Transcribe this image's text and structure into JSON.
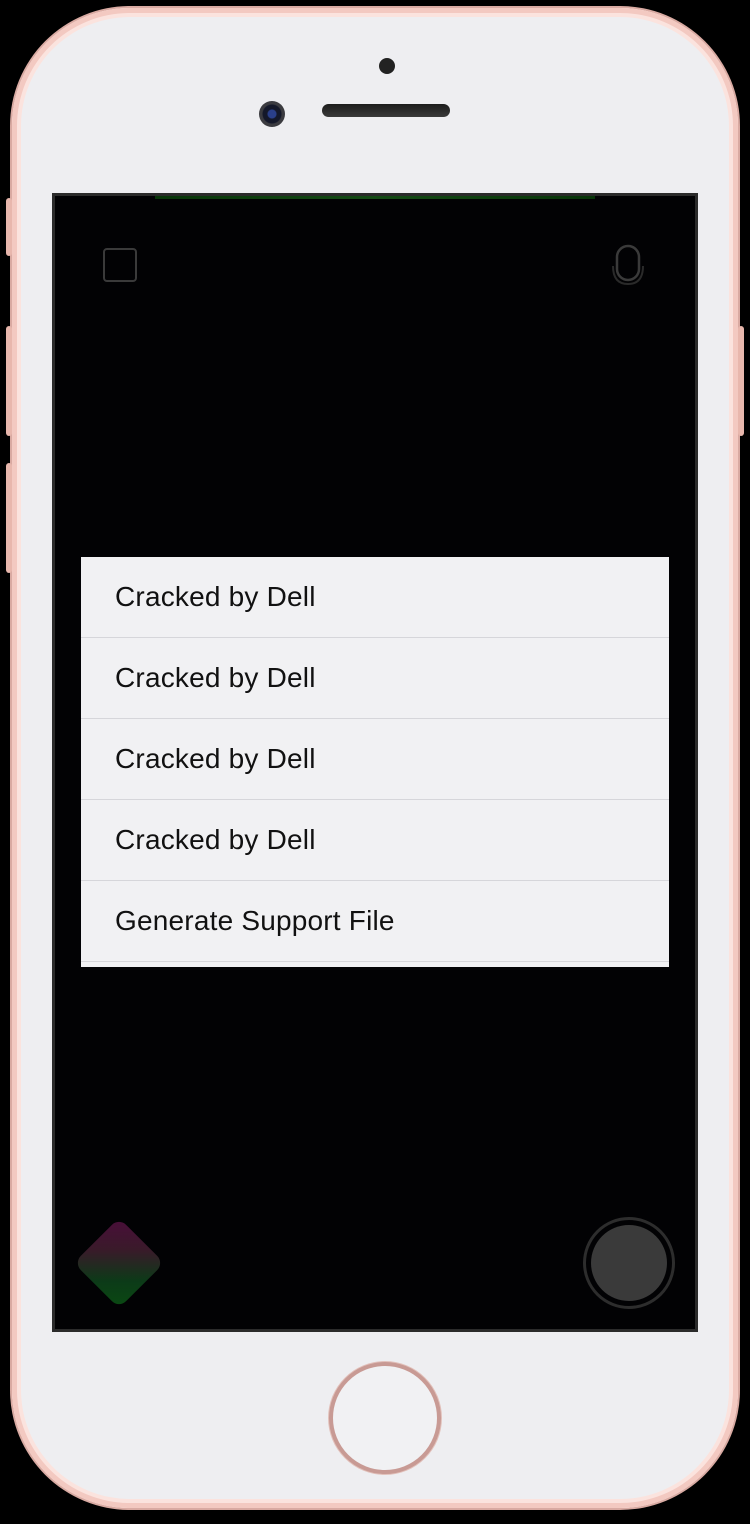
{
  "menu": {
    "items": [
      {
        "label": "Cracked by Dell"
      },
      {
        "label": "Cracked by Dell"
      },
      {
        "label": "Cracked by Dell"
      },
      {
        "label": "Cracked by Dell"
      },
      {
        "label": "Generate Support File"
      }
    ]
  },
  "icons": {
    "top_left": "frame-icon",
    "top_right": "microphone-icon",
    "bottom_left": "color-diamond-icon",
    "bottom_right": "shutter-button"
  },
  "colors": {
    "phone_frame": "#eeeef1",
    "phone_trim": "#f3c9c1",
    "screen_bg": "#020204",
    "menu_bg": "#f1f1f3",
    "menu_text": "#111111"
  }
}
